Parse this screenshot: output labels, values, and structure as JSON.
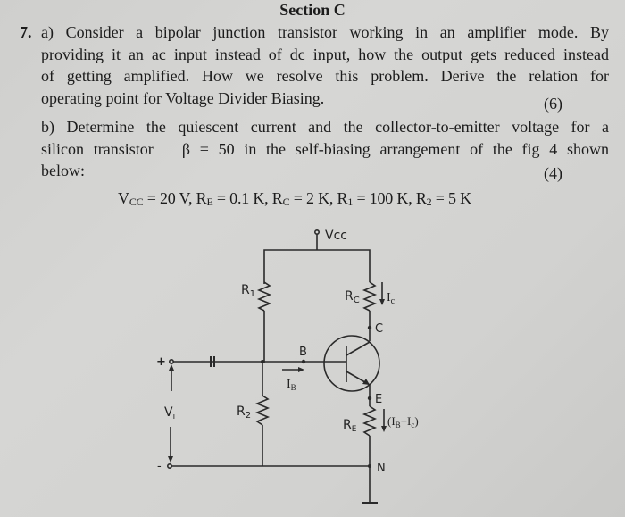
{
  "section_title": "Section C",
  "question": {
    "number": "7.",
    "part_a": {
      "lines": [
        "a) Consider a bipolar junction transistor working in an amplifier mode. By",
        "providing it an ac input instead of dc input, how the output gets reduced instead",
        "of getting amplified. How we resolve this problem. Derive the relation for",
        "operating point for Voltage Divider Biasing."
      ],
      "marks": "(6)"
    },
    "part_b": {
      "lines": [
        "b) Determine the quiescent current and the collector-to-emitter voltage for a",
        "silicon transistor   β = 50 in the self-biasing arrangement of the fig 4 shown",
        "below:"
      ],
      "marks": "(4)"
    },
    "parameters": {
      "vcc": {
        "symbol": "V",
        "sub": "CC",
        "value": "= 20 V,"
      },
      "re": {
        "symbol": "R",
        "sub": "E",
        "value": "= 0.1 K,"
      },
      "rc": {
        "symbol": "R",
        "sub": "C",
        "value": "= 2 K,"
      },
      "r1": {
        "symbol": "R",
        "sub": "1",
        "value": "= 100 K,"
      },
      "r2": {
        "symbol": "R",
        "sub": "2",
        "value": "= 5 K"
      }
    }
  },
  "circuit": {
    "labels": {
      "vcc": "Vcc",
      "r1": "R",
      "r1_sub": "1",
      "r2": "R",
      "r2_sub": "2",
      "rc": "R",
      "rc_sub": "C",
      "re": "R",
      "re_sub": "E",
      "ic": "I",
      "ic_sub": "c",
      "ib": "I",
      "ib_sub": "B",
      "ie": "(I",
      "ie_sub1": "B",
      "ie_mid": "+I",
      "ie_sub2": "c",
      "ie_end": ")",
      "node_b": "B",
      "node_c": "C",
      "node_e": "E",
      "node_n": "N",
      "vi": "V",
      "vi_sub": "i",
      "plus": "+",
      "minus": "-"
    }
  }
}
